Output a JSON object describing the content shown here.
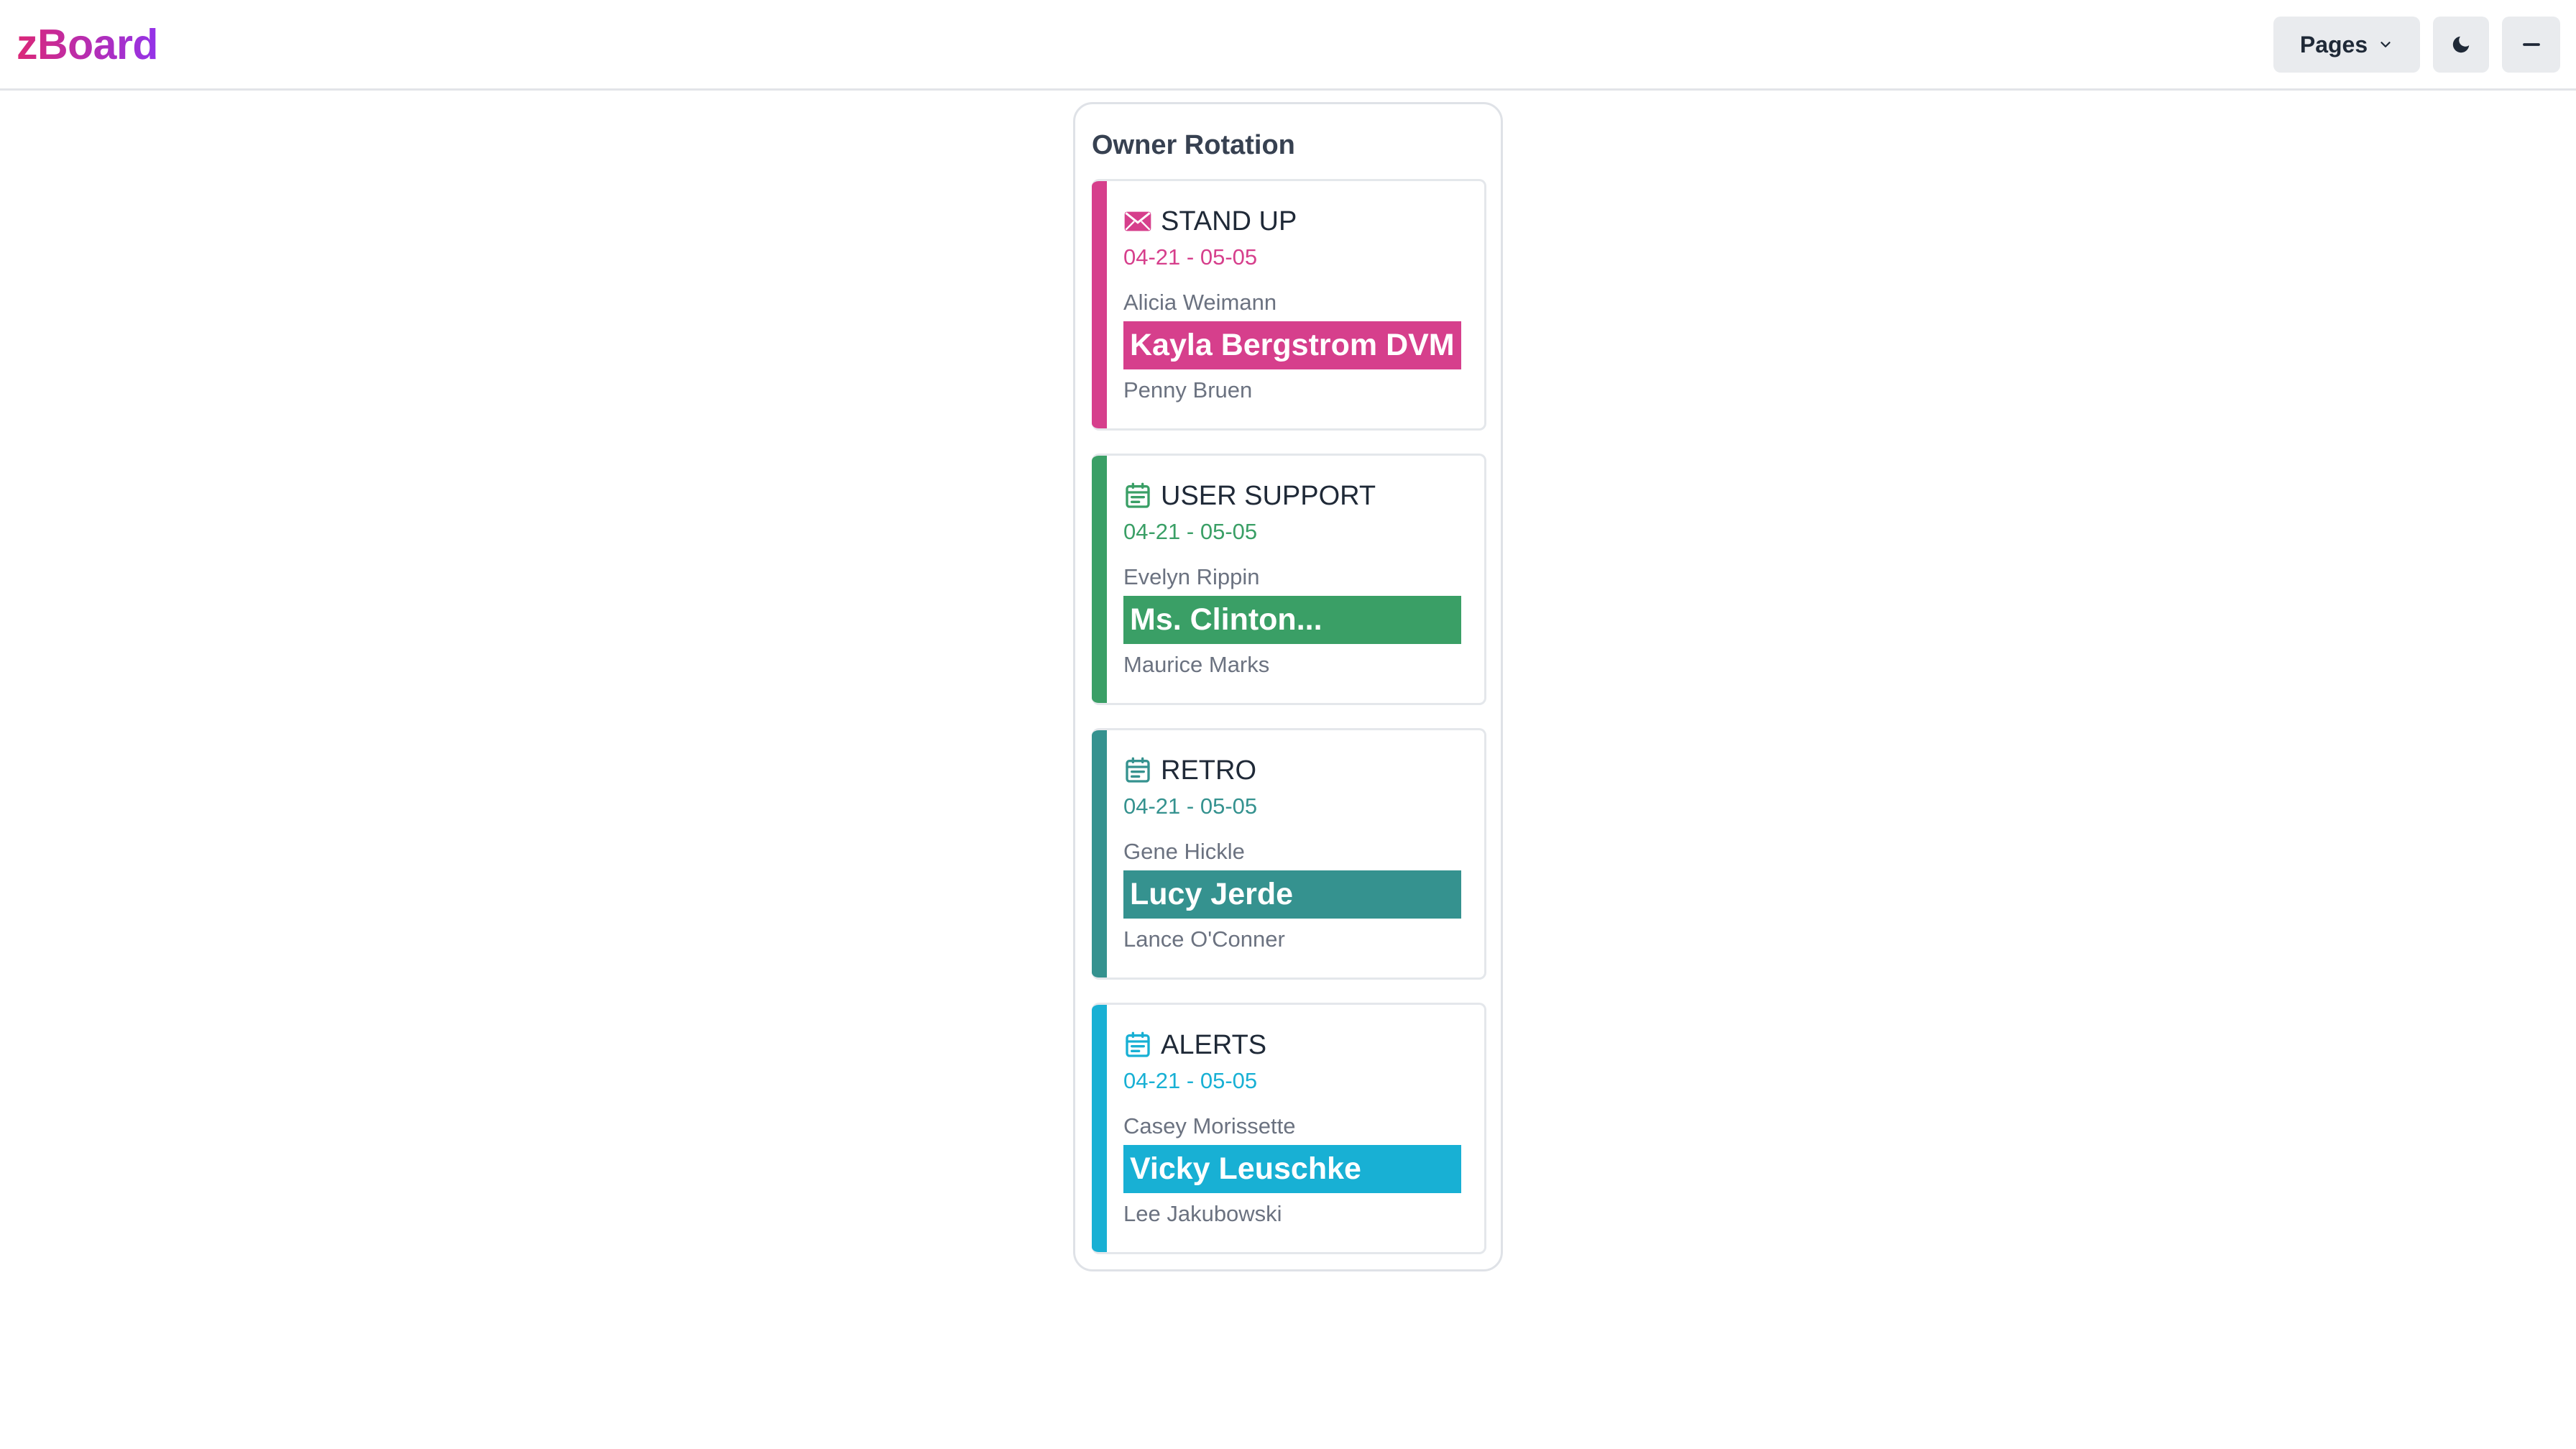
{
  "header": {
    "logo": "zBoard",
    "pages_label": "Pages",
    "icons": {
      "pages": "chevron-down-icon",
      "theme": "moon-icon",
      "minimize": "minus-icon"
    }
  },
  "panel": {
    "title": "Owner Rotation"
  },
  "cards": [
    {
      "title": "STAND UP",
      "icon": "mail-icon",
      "range": "04-21 - 05-05",
      "previous": "Alicia Weimann",
      "current": "Kayla Bergstrom DVM",
      "next": "Penny Bruen",
      "color": "#d63f8c"
    },
    {
      "title": "USER SUPPORT",
      "icon": "calendar-icon",
      "range": "04-21 - 05-05",
      "previous": "Evelyn Rippin",
      "current": "Ms. Clinton...",
      "next": "Maurice Marks",
      "color": "#3a9f66"
    },
    {
      "title": "RETRO",
      "icon": "calendar-icon",
      "range": "04-21 - 05-05",
      "previous": "Gene Hickle",
      "current": "Lucy Jerde",
      "next": "Lance O'Conner",
      "color": "#35928f"
    },
    {
      "title": "ALERTS",
      "icon": "calendar-icon",
      "range": "04-21 - 05-05",
      "previous": "Casey Morissette",
      "current": "Vicky Leuschke",
      "next": "Lee Jakubowski",
      "color": "#18b0d4"
    }
  ]
}
